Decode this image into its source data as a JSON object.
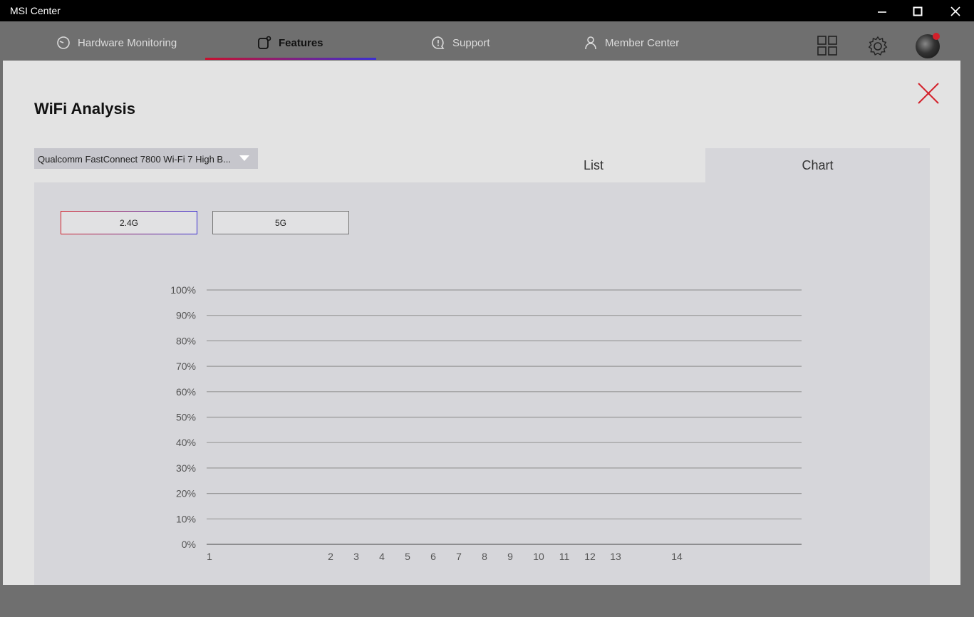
{
  "window": {
    "title": "MSI Center"
  },
  "nav": {
    "tabs": [
      {
        "label": "Hardware Monitoring",
        "icon": "gauge-icon"
      },
      {
        "label": "Features",
        "icon": "features-icon",
        "active": true
      },
      {
        "label": "Support",
        "icon": "chat-icon"
      },
      {
        "label": "Member Center",
        "icon": "person-icon"
      }
    ],
    "right_icons": [
      "grid-icon",
      "gear-icon",
      "avatar"
    ]
  },
  "panel": {
    "title": "WiFi Analysis",
    "adapter_select": "Qualcomm FastConnect 7800 Wi-Fi 7 High B...",
    "view_tabs": [
      {
        "label": "List",
        "active": false
      },
      {
        "label": "Chart",
        "active": true
      }
    ],
    "bands": [
      {
        "label": "2.4G",
        "active": true
      },
      {
        "label": "5G",
        "active": false
      }
    ]
  },
  "colors": {
    "accent_red": "#d3202a",
    "accent_blue": "#3b2fd1",
    "panel_bg": "#e3e3e3",
    "chart_bg": "#d6d6da"
  },
  "chart_data": {
    "type": "area",
    "y_tick_labels": [
      "0%",
      "10%",
      "20%",
      "30%",
      "40%",
      "50%",
      "60%",
      "70%",
      "80%",
      "90%",
      "100%"
    ],
    "x_tick_labels": [
      "1",
      "2",
      "3",
      "4",
      "5",
      "6",
      "7",
      "8",
      "9",
      "10",
      "11",
      "12",
      "13",
      "14"
    ],
    "ylim": [
      0,
      100
    ],
    "grid": true,
    "series": []
  }
}
